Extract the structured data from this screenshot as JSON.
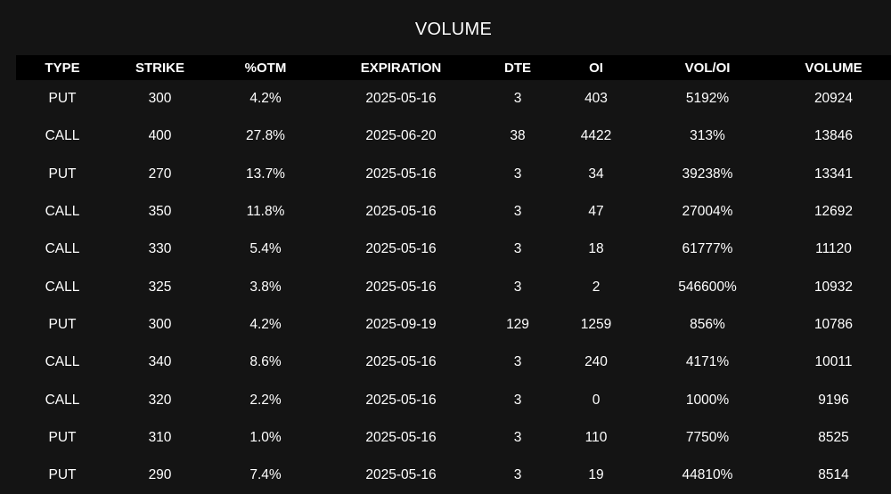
{
  "title": "VOLUME",
  "colors": {
    "background": "#141414",
    "header_background": "#000000",
    "put": "#ff2b2b",
    "call": "#33dd33",
    "vol_oi": "#7ec8f0",
    "text": "#ffffff"
  },
  "columns": [
    "TYPE",
    "STRIKE",
    "%OTM",
    "EXPIRATION",
    "DTE",
    "OI",
    "VOL/OI",
    "VOLUME"
  ],
  "rows": [
    {
      "type": "PUT",
      "strike": "300",
      "otm": "4.2%",
      "expiration": "2025-05-16",
      "dte": "3",
      "oi": "403",
      "vol_oi": "5192%",
      "volume": "20924"
    },
    {
      "type": "CALL",
      "strike": "400",
      "otm": "27.8%",
      "expiration": "2025-06-20",
      "dte": "38",
      "oi": "4422",
      "vol_oi": "313%",
      "volume": "13846"
    },
    {
      "type": "PUT",
      "strike": "270",
      "otm": "13.7%",
      "expiration": "2025-05-16",
      "dte": "3",
      "oi": "34",
      "vol_oi": "39238%",
      "volume": "13341"
    },
    {
      "type": "CALL",
      "strike": "350",
      "otm": "11.8%",
      "expiration": "2025-05-16",
      "dte": "3",
      "oi": "47",
      "vol_oi": "27004%",
      "volume": "12692"
    },
    {
      "type": "CALL",
      "strike": "330",
      "otm": "5.4%",
      "expiration": "2025-05-16",
      "dte": "3",
      "oi": "18",
      "vol_oi": "61777%",
      "volume": "11120"
    },
    {
      "type": "CALL",
      "strike": "325",
      "otm": "3.8%",
      "expiration": "2025-05-16",
      "dte": "3",
      "oi": "2",
      "vol_oi": "546600%",
      "volume": "10932"
    },
    {
      "type": "PUT",
      "strike": "300",
      "otm": "4.2%",
      "expiration": "2025-09-19",
      "dte": "129",
      "oi": "1259",
      "vol_oi": "856%",
      "volume": "10786"
    },
    {
      "type": "CALL",
      "strike": "340",
      "otm": "8.6%",
      "expiration": "2025-05-16",
      "dte": "3",
      "oi": "240",
      "vol_oi": "4171%",
      "volume": "10011"
    },
    {
      "type": "CALL",
      "strike": "320",
      "otm": "2.2%",
      "expiration": "2025-05-16",
      "dte": "3",
      "oi": "0",
      "vol_oi": "1000%",
      "volume": "9196"
    },
    {
      "type": "PUT",
      "strike": "310",
      "otm": "1.0%",
      "expiration": "2025-05-16",
      "dte": "3",
      "oi": "110",
      "vol_oi": "7750%",
      "volume": "8525"
    },
    {
      "type": "PUT",
      "strike": "290",
      "otm": "7.4%",
      "expiration": "2025-05-16",
      "dte": "3",
      "oi": "19",
      "vol_oi": "44810%",
      "volume": "8514"
    }
  ]
}
